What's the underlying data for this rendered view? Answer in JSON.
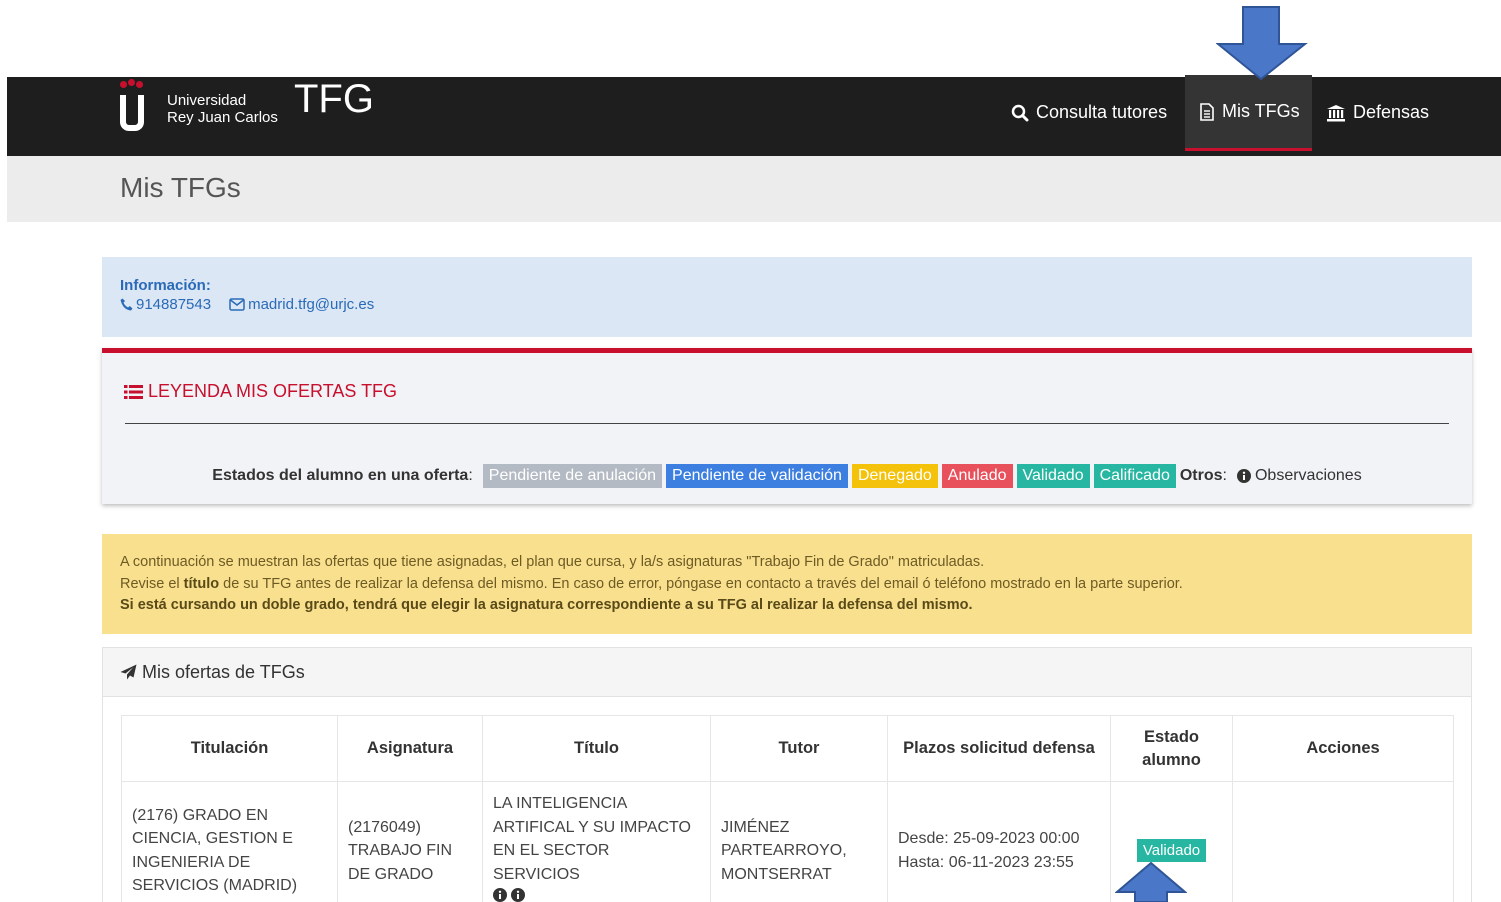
{
  "navbar": {
    "logo_line1": "Universidad",
    "logo_line2": "Rey Juan Carlos",
    "app_title": "TFG",
    "items": [
      {
        "label": "Consulta tutores",
        "icon": "search-icon"
      },
      {
        "label": "Mis TFGs",
        "icon": "document-icon",
        "active": true
      },
      {
        "label": "Defensas",
        "icon": "bank-icon"
      }
    ]
  },
  "page": {
    "title": "Mis TFGs"
  },
  "info": {
    "label": "Información:",
    "phone": "914887543",
    "email": "madrid.tfg@urjc.es"
  },
  "legend": {
    "title": "LEYENDA MIS OFERTAS TFG",
    "states_label": "Estados del alumno en una oferta",
    "states": [
      {
        "label": "Pendiente de anulación",
        "color": "#b4bac3"
      },
      {
        "label": "Pendiente de validación",
        "color": "#3c7fe0"
      },
      {
        "label": "Denegado",
        "color": "#f4c20b"
      },
      {
        "label": "Anulado",
        "color": "#e8505b"
      },
      {
        "label": "Validado",
        "color": "#26b6a1"
      },
      {
        "label": "Calificado",
        "color": "#26b6a1"
      }
    ],
    "others_label": "Otros",
    "observations": "Observaciones"
  },
  "warning": {
    "line1": "A continuación se muestran las ofertas que tiene asignadas, el plan que cursa, y la/s asignaturas \"Trabajo Fin de Grado\" matriculadas.",
    "line2_pre": "Revise el ",
    "line2_bold": "título",
    "line2_post": " de su TFG antes de realizar la defensa del mismo. En caso de error, póngase en contacto a través del email ó teléfono mostrado en la parte superior.",
    "line3": "Si está cursando un doble grado, tendrá que elegir la asignatura correspondiente a su TFG al realizar la defensa del mismo."
  },
  "offers": {
    "title": "Mis ofertas de TFGs",
    "columns": [
      "Titulación",
      "Asignatura",
      "Título",
      "Tutor",
      "Plazos solicitud defensa",
      "Estado alumno",
      "Acciones"
    ],
    "rows": [
      {
        "titulacion": "(2176) GRADO EN CIENCIA, GESTION E INGENIERIA DE SERVICIOS (MADRID)",
        "asignatura": "(2176049) TRABAJO FIN DE GRADO",
        "titulo": "LA INTELIGENCIA ARTIFICAL Y SU IMPACTO EN EL SECTOR SERVICIOS",
        "tutor": "JIMÉNEZ PARTEARROYO, MONTSERRAT",
        "plazo_desde": "Desde: 25-09-2023 00:00",
        "plazo_hasta": "Hasta: 06-11-2023 23:55",
        "estado": "Validado",
        "acciones": ""
      }
    ]
  }
}
